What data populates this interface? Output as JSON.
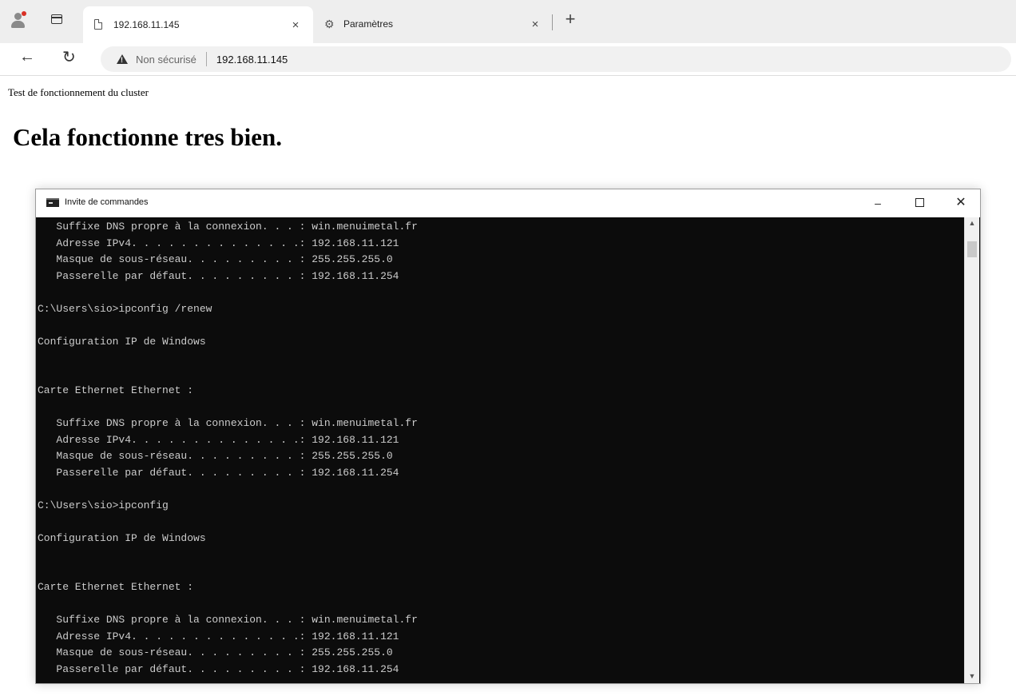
{
  "browser": {
    "tabs": [
      {
        "title": "192.168.11.145",
        "icon": "document-icon",
        "active": true
      },
      {
        "title": "Paramètres",
        "icon": "gear-icon",
        "active": false
      }
    ],
    "close_glyph": "×",
    "new_tab_glyph": "+",
    "address": {
      "security_label": "Non sécurisé",
      "url": "192.168.11.145"
    }
  },
  "page": {
    "intro": "Test de fonctionnement du cluster",
    "heading": "Cela fonctionne tres bien."
  },
  "console": {
    "title": "Invite de commandes",
    "controls": {
      "minimize": "–",
      "close": "✕"
    },
    "lines": [
      "   Suffixe DNS propre à la connexion. . . : win.menuimetal.fr",
      "   Adresse IPv4. . . . . . . . . . . . . .: 192.168.11.121",
      "   Masque de sous-réseau. . . . . . . . . : 255.255.255.0",
      "   Passerelle par défaut. . . . . . . . . : 192.168.11.254",
      "",
      "C:\\Users\\sio>ipconfig /renew",
      "",
      "Configuration IP de Windows",
      "",
      "",
      "Carte Ethernet Ethernet :",
      "",
      "   Suffixe DNS propre à la connexion. . . : win.menuimetal.fr",
      "   Adresse IPv4. . . . . . . . . . . . . .: 192.168.11.121",
      "   Masque de sous-réseau. . . . . . . . . : 255.255.255.0",
      "   Passerelle par défaut. . . . . . . . . : 192.168.11.254",
      "",
      "C:\\Users\\sio>ipconfig",
      "",
      "Configuration IP de Windows",
      "",
      "",
      "Carte Ethernet Ethernet :",
      "",
      "   Suffixe DNS propre à la connexion. . . : win.menuimetal.fr",
      "   Adresse IPv4. . . . . . . . . . . . . .: 192.168.11.121",
      "   Masque de sous-réseau. . . . . . . . . : 255.255.255.0",
      "   Passerelle par défaut. . . . . . . . . : 192.168.11.254",
      ""
    ],
    "prompt": "C:\\Users\\sio>",
    "cursor": "_",
    "colors": {
      "background": "#0c0c0c",
      "text": "#cccccc"
    }
  }
}
